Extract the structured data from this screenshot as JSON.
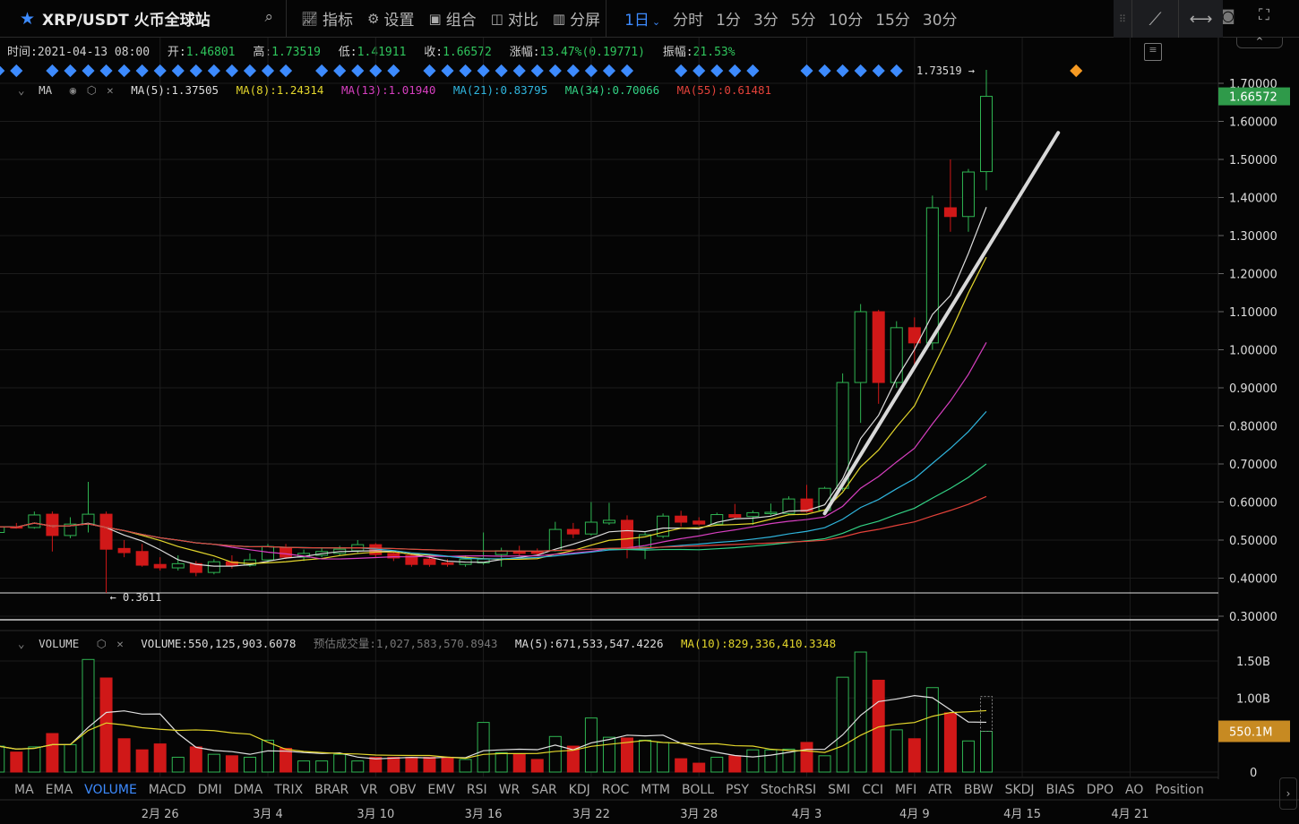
{
  "header": {
    "symbol": "XRP/USDT 火币全球站",
    "star_icon": "star",
    "search_icon": "search"
  },
  "toolbar": {
    "items": [
      {
        "label": "指标",
        "icon": "indicator-icon"
      },
      {
        "label": "设置",
        "icon": "gear-icon"
      },
      {
        "label": "组合",
        "icon": "layout-icon"
      },
      {
        "label": "对比",
        "icon": "compare-icon"
      },
      {
        "label": "分屏",
        "icon": "split-icon"
      }
    ]
  },
  "timeframes": {
    "active": "1日",
    "items": [
      "分时",
      "1分",
      "3分",
      "5分",
      "10分",
      "15分",
      "30分"
    ]
  },
  "info": {
    "time_label": "时间:",
    "time": "2021-04-13 08:00",
    "open_label": "开:",
    "open": "1.46801",
    "high_label": "高:",
    "high": "1.73519",
    "low_label": "低:",
    "low": "1.41911",
    "close_label": "收:",
    "close": "1.66572",
    "change_label": "涨幅:",
    "change": "13.47%(0.19771)",
    "amplitude_label": "振幅:",
    "amplitude": "21.53%"
  },
  "ma_legend": {
    "name": "MA",
    "items": [
      {
        "label": "MA(5):1.37505",
        "color": "#dcdcdc"
      },
      {
        "label": "MA(8):1.24314",
        "color": "#e3d62c"
      },
      {
        "label": "MA(13):1.01940",
        "color": "#d63fbf"
      },
      {
        "label": "MA(21):0.83795",
        "color": "#2fb4dc"
      },
      {
        "label": "MA(34):0.70066",
        "color": "#33d285"
      },
      {
        "label": "MA(55):0.61481",
        "color": "#e4423a"
      }
    ]
  },
  "volume_legend": {
    "name": "VOLUME",
    "items": [
      {
        "label": "VOLUME:550,125,903.6078",
        "color": "#dcdcdc"
      },
      {
        "label": "预估成交量:1,027,583,570.8943",
        "color": "#777777"
      },
      {
        "label": "MA(5):671,533,547.4226",
        "color": "#dcdcdc"
      },
      {
        "label": "MA(10):829,336,410.3348",
        "color": "#e3d62c"
      }
    ]
  },
  "indicator_tabs": {
    "active": "VOLUME",
    "items": [
      "MA",
      "EMA",
      "VOLUME",
      "MACD",
      "DMI",
      "DMA",
      "TRIX",
      "BRAR",
      "VR",
      "OBV",
      "EMV",
      "RSI",
      "WR",
      "SAR",
      "KDJ",
      "ROC",
      "MTM",
      "BOLL",
      "PSY",
      "StochRSI",
      "SMI",
      "CCI",
      "MFI",
      "ATR",
      "BBW",
      "SKDJ",
      "BIAS",
      "DPO",
      "AO",
      "Position"
    ]
  },
  "colors": {
    "up": "#2fb552",
    "down": "#d01818",
    "accent": "#3d8bff",
    "price_tag": "#2f9a4a",
    "volume_tag": "#c78a22"
  },
  "chart_data": {
    "type": "candlestick",
    "price_axis": {
      "min": 0.3,
      "max": 1.7,
      "ticks": [
        "1.70000",
        "1.60000",
        "1.50000",
        "1.40000",
        "1.30000",
        "1.20000",
        "1.10000",
        "1.00000",
        "0.90000",
        "0.80000",
        "0.70000",
        "0.60000",
        "0.50000",
        "0.40000",
        "0.30000"
      ]
    },
    "volume_axis": {
      "ticks": [
        {
          "label": "1.50B",
          "value": 1.5
        },
        {
          "label": "1.00B",
          "value": 1.0
        },
        {
          "label": "0",
          "value": 0
        }
      ]
    },
    "date_ticks": [
      {
        "label": "2月 26",
        "index": 9
      },
      {
        "label": "3月 4",
        "index": 15
      },
      {
        "label": "3月 10",
        "index": 21
      },
      {
        "label": "3月 16",
        "index": 27
      },
      {
        "label": "3月 22",
        "index": 33
      },
      {
        "label": "3月 28",
        "index": 39
      },
      {
        "label": "4月 3",
        "index": 45
      },
      {
        "label": "4月 9",
        "index": 51
      },
      {
        "label": "4月 15",
        "index": 57
      },
      {
        "label": "4月 21",
        "index": 63
      }
    ],
    "high_marker": "1.73519 →",
    "low_marker": "← 0.3611",
    "low_value": 0.3611,
    "last_price": "1.66572",
    "last_volume": "550.1M",
    "signal_indices": [
      0,
      1,
      3,
      4,
      5,
      6,
      7,
      8,
      9,
      10,
      11,
      12,
      13,
      14,
      15,
      16,
      18,
      19,
      20,
      21,
      22,
      24,
      25,
      26,
      27,
      28,
      29,
      30,
      31,
      32,
      33,
      34,
      35,
      38,
      39,
      40,
      41,
      42,
      45,
      46,
      47,
      48,
      49,
      50
    ],
    "signal_future_index": 60,
    "trend_line": [
      {
        "index": 46,
        "price": 0.57
      },
      {
        "index": 59,
        "price": 1.57
      }
    ],
    "ohlc": [
      [
        0.52,
        0.54,
        0.51,
        0.535
      ],
      [
        0.535,
        0.545,
        0.53,
        0.533
      ],
      [
        0.533,
        0.575,
        0.53,
        0.566
      ],
      [
        0.568,
        0.575,
        0.47,
        0.512
      ],
      [
        0.512,
        0.56,
        0.505,
        0.542
      ],
      [
        0.542,
        0.653,
        0.52,
        0.568
      ],
      [
        0.568,
        0.575,
        0.3611,
        0.476
      ],
      [
        0.478,
        0.5,
        0.455,
        0.467
      ],
      [
        0.47,
        0.49,
        0.43,
        0.434
      ],
      [
        0.436,
        0.455,
        0.42,
        0.427
      ],
      [
        0.427,
        0.46,
        0.42,
        0.438
      ],
      [
        0.438,
        0.445,
        0.405,
        0.415
      ],
      [
        0.415,
        0.45,
        0.41,
        0.443
      ],
      [
        0.443,
        0.46,
        0.425,
        0.434
      ],
      [
        0.434,
        0.465,
        0.43,
        0.448
      ],
      [
        0.448,
        0.49,
        0.44,
        0.483
      ],
      [
        0.481,
        0.49,
        0.45,
        0.455
      ],
      [
        0.455,
        0.475,
        0.445,
        0.465
      ],
      [
        0.46,
        0.478,
        0.455,
        0.47
      ],
      [
        0.465,
        0.485,
        0.46,
        0.476
      ],
      [
        0.472,
        0.5,
        0.465,
        0.488
      ],
      [
        0.488,
        0.492,
        0.455,
        0.462
      ],
      [
        0.465,
        0.47,
        0.445,
        0.453
      ],
      [
        0.46,
        0.465,
        0.43,
        0.436
      ],
      [
        0.45,
        0.46,
        0.43,
        0.436
      ],
      [
        0.44,
        0.45,
        0.43,
        0.436
      ],
      [
        0.436,
        0.46,
        0.43,
        0.45
      ],
      [
        0.44,
        0.52,
        0.435,
        0.45
      ],
      [
        0.462,
        0.48,
        0.43,
        0.472
      ],
      [
        0.47,
        0.485,
        0.46,
        0.465
      ],
      [
        0.47,
        0.478,
        0.46,
        0.465
      ],
      [
        0.472,
        0.548,
        0.47,
        0.528
      ],
      [
        0.528,
        0.545,
        0.505,
        0.516
      ],
      [
        0.516,
        0.6,
        0.512,
        0.547
      ],
      [
        0.545,
        0.598,
        0.54,
        0.552
      ],
      [
        0.552,
        0.565,
        0.452,
        0.481
      ],
      [
        0.481,
        0.52,
        0.45,
        0.514
      ],
      [
        0.51,
        0.57,
        0.505,
        0.563
      ],
      [
        0.563,
        0.577,
        0.535,
        0.547
      ],
      [
        0.55,
        0.56,
        0.538,
        0.542
      ],
      [
        0.542,
        0.572,
        0.538,
        0.567
      ],
      [
        0.567,
        0.595,
        0.555,
        0.56
      ],
      [
        0.562,
        0.578,
        0.54,
        0.572
      ],
      [
        0.57,
        0.596,
        0.565,
        0.573
      ],
      [
        0.57,
        0.615,
        0.565,
        0.608
      ],
      [
        0.608,
        0.645,
        0.572,
        0.575
      ],
      [
        0.578,
        0.64,
        0.575,
        0.636
      ],
      [
        0.636,
        0.938,
        0.63,
        0.914
      ],
      [
        0.914,
        1.12,
        0.808,
        1.1
      ],
      [
        1.1,
        1.105,
        0.858,
        0.914
      ],
      [
        0.914,
        1.075,
        0.9,
        1.058
      ],
      [
        1.058,
        1.085,
        0.95,
        1.018
      ],
      [
        1.018,
        1.405,
        1.0,
        1.373
      ],
      [
        1.373,
        1.5,
        1.31,
        1.35
      ],
      [
        1.35,
        1.475,
        1.31,
        1.467
      ],
      [
        1.46801,
        1.73519,
        1.41911,
        1.66572
      ]
    ],
    "volume_billions": [
      0.35,
      0.27,
      0.34,
      0.52,
      0.37,
      1.52,
      1.27,
      0.45,
      0.3,
      0.38,
      0.2,
      0.34,
      0.24,
      0.22,
      0.2,
      0.43,
      0.32,
      0.15,
      0.15,
      0.24,
      0.15,
      0.2,
      0.2,
      0.2,
      0.2,
      0.2,
      0.17,
      0.67,
      0.26,
      0.24,
      0.17,
      0.48,
      0.35,
      0.73,
      0.47,
      0.46,
      0.43,
      0.4,
      0.18,
      0.12,
      0.2,
      0.22,
      0.3,
      0.3,
      0.31,
      0.4,
      0.22,
      1.28,
      1.62,
      1.24,
      0.57,
      0.45,
      1.14,
      0.8,
      0.42,
      0.55
    ],
    "ma_periods": [
      5,
      8,
      13,
      21,
      34,
      55
    ],
    "volume_ma_periods": [
      5,
      10
    ]
  }
}
